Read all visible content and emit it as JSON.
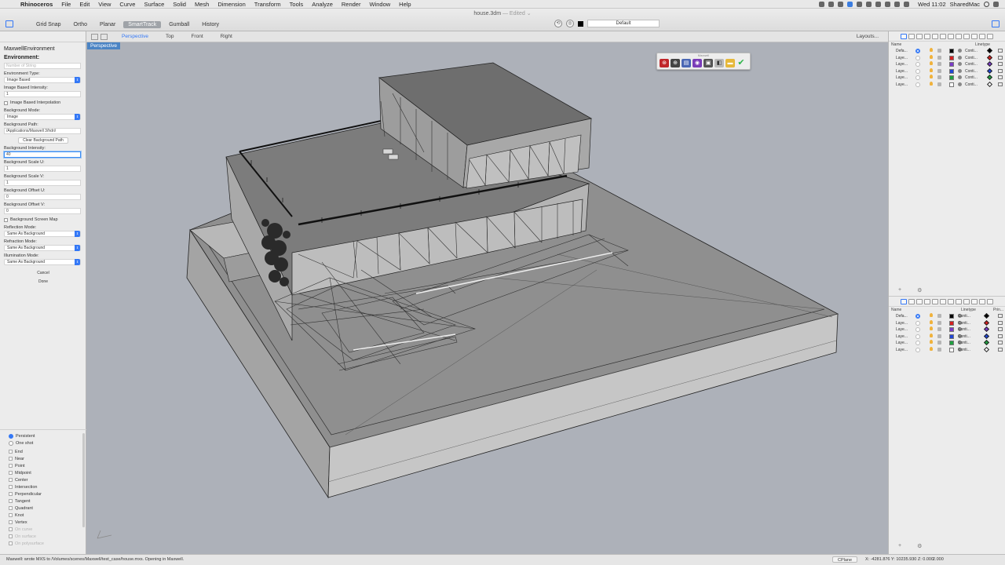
{
  "menubar": {
    "app": "Rhinoceros",
    "items": [
      "File",
      "Edit",
      "View",
      "Curve",
      "Surface",
      "Solid",
      "Mesh",
      "Dimension",
      "Transform",
      "Tools",
      "Analyze",
      "Render",
      "Window",
      "Help"
    ],
    "clock": "Wed 11:02",
    "user": "SharedMac"
  },
  "window": {
    "title": "house.3dm",
    "edited": "— Edited ⌄"
  },
  "toolbar": {
    "buttons": [
      "Grid Snap",
      "Ortho",
      "Planar",
      "SmartTrack",
      "Gumball",
      "History"
    ],
    "active": "SmartTrack",
    "layer": "Default"
  },
  "left_panel": {
    "title": "MaxwellEnvironment",
    "section": "Environment:",
    "name_placeholder": "Number of String",
    "environment_type_label": "Environment Type:",
    "environment_type_value": "Image Based",
    "ib_intensity_label": "Image Based Intensity:",
    "ib_intensity_value": "1",
    "ib_interpolation_label": "Image Based Interpolation",
    "bg_mode_label": "Background Mode:",
    "bg_mode_value": "Image",
    "bg_path_label": "Background Path:",
    "bg_path_value": "/Applications/Maxwell 3/hdri/",
    "clear_bg_button": "Clear Background Path",
    "bg_intensity_label": "Background Intensity:",
    "bg_intensity_value": "40",
    "bg_scale_u_label": "Background Scale U:",
    "bg_scale_u_value": "1",
    "bg_scale_v_label": "Background Scale V:",
    "bg_scale_v_value": "1",
    "bg_offset_u_label": "Background Offset U:",
    "bg_offset_u_value": "0",
    "bg_offset_v_label": "Background Offset V:",
    "bg_offset_v_value": "0",
    "bg_screen_map_label": "Background Screen Map",
    "reflection_mode_label": "Reflection Mode:",
    "reflection_mode_value": "Same As Background",
    "refraction_mode_label": "Refraction Mode:",
    "refraction_mode_value": "Same As Background",
    "illumination_mode_label": "Illumination Mode:",
    "illumination_mode_value": "Same As Background",
    "cancel_button": "Cancel",
    "done_button": "Done"
  },
  "osnap": {
    "persistent": "Persistent",
    "one_shot": "One shot",
    "items": [
      "End",
      "Near",
      "Point",
      "Midpoint",
      "Center",
      "Intersection",
      "Perpendicular",
      "Tangent",
      "Quadrant",
      "Knot",
      "Vertex"
    ],
    "disabled_items": [
      "On curve",
      "On surface",
      "On polysurface"
    ]
  },
  "viewtabs": {
    "tabs": [
      "Perspective",
      "Top",
      "Front",
      "Right"
    ],
    "active": "Perspective",
    "layouts": "Layouts..."
  },
  "viewport": {
    "label": "Perspective",
    "maxwell_toolbar_title": "Maxwell",
    "maxwell_icons": [
      "maxwell-render-icon",
      "maxwell-fire-icon",
      "maxwell-export-icon",
      "maxwell-material-icon",
      "maxwell-camera-icon",
      "maxwell-environment-icon",
      "maxwell-folder-icon",
      "maxwell-check-icon"
    ]
  },
  "layers_panel": {
    "col_name": "Name",
    "col_linetype": "Linetype",
    "col_print": "Prin...",
    "rows": [
      {
        "name": "Defa...",
        "current": true,
        "color": "#000000",
        "linetype": "Conti..."
      },
      {
        "name": "Laye...",
        "current": false,
        "color": "#d42020",
        "linetype": "Conti..."
      },
      {
        "name": "Laye...",
        "current": false,
        "color": "#7a3cc8",
        "linetype": "Conti..."
      },
      {
        "name": "Laye...",
        "current": false,
        "color": "#2045d4",
        "linetype": "Conti..."
      },
      {
        "name": "Laye...",
        "current": false,
        "color": "#20a040",
        "linetype": "Conti..."
      },
      {
        "name": "Laye...",
        "current": false,
        "color": "#ffffff",
        "linetype": "Conti..."
      }
    ]
  },
  "statusbar": {
    "message": "Maxwell: wrote MXS to /Volumes/scenes/Maxwell/test_case/house.mxs. Opening in Maxwell.",
    "cplane": "CPlane",
    "coords": "X: -4281.876  Y: 10235.930  Z: 0.000",
    "distance": "2.000"
  }
}
